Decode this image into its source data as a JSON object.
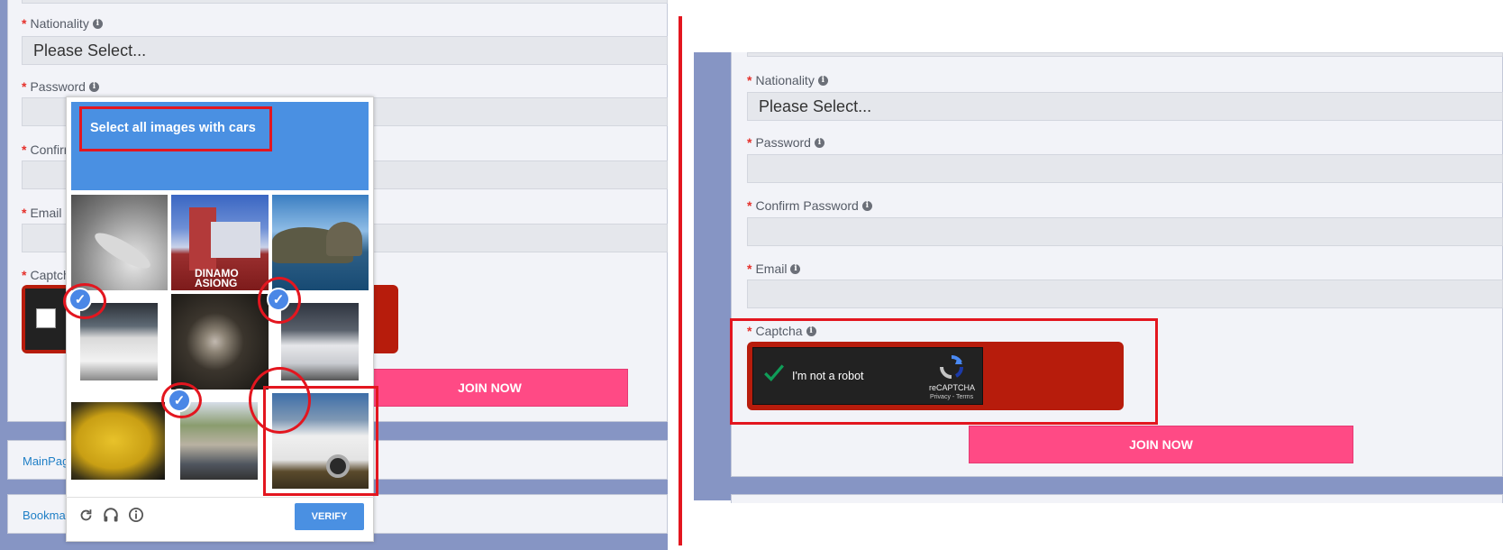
{
  "left": {
    "nationality_label": "Nationality",
    "nationality_value": "Please Select...",
    "password_label": "Password",
    "confirm_label_partial": "Confirm",
    "email_label_partial": "Email",
    "captcha_label_partial": "Captch",
    "join_label": "JOIN NOW",
    "nav_mainpage_partial": "MainPag",
    "nav_bookmarks_partial": "Bookmar"
  },
  "challenge": {
    "instruction": "Select all images with cars",
    "tiles": [
      {
        "name": "tile-spoon",
        "selected": false
      },
      {
        "name": "tile-dinamo-sign",
        "selected": false,
        "caption": "DINAMO ASIONG"
      },
      {
        "name": "tile-coastal-cliffs",
        "selected": false
      },
      {
        "name": "tile-white-car-rear",
        "selected": true
      },
      {
        "name": "tile-dark-wheel",
        "selected": false
      },
      {
        "name": "tile-silver-convertible",
        "selected": true
      },
      {
        "name": "tile-yellow-object",
        "selected": false
      },
      {
        "name": "tile-building-street",
        "selected": true
      },
      {
        "name": "tile-white-van",
        "selected": false
      }
    ],
    "verify_label": "VERIFY",
    "icons": [
      "reload-icon",
      "headphones-icon",
      "info-icon"
    ]
  },
  "right": {
    "nationality_label": "Nationality",
    "nationality_value": "Please Select...",
    "password_label": "Password",
    "confirm_label": "Confirm Password",
    "email_label": "Email",
    "captcha_label": "Captcha",
    "recaptcha_text": "I'm not a robot",
    "recaptcha_brand": "reCAPTCHA",
    "recaptcha_links": "Privacy - Terms",
    "join_label": "JOIN NOW"
  },
  "colors": {
    "accent_pink": "#ff4a85",
    "captcha_red": "#b71c0c",
    "annotation_red": "#e3161f",
    "challenge_blue": "#4a90e2"
  }
}
